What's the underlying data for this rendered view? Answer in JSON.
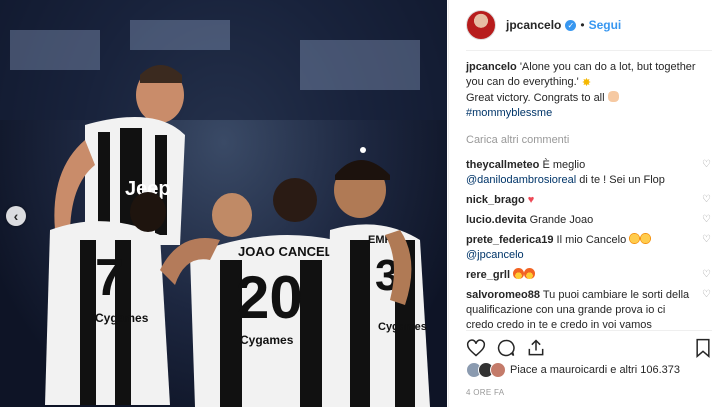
{
  "post": {
    "photo": {
      "description_icon": "photo-icon",
      "jersey_texts": {
        "sponsor": "Jeep",
        "name": "JOAO CANCELO",
        "number_center": "20",
        "number_left": "7",
        "number_right": "3",
        "name_right": "EMRE",
        "sponsor_bottom": "Cygames"
      },
      "prev_icon": "chevron-left-icon"
    },
    "header": {
      "username": "jpcancelo",
      "verified_icon": "verified-badge-icon",
      "separator": "•",
      "follow_label": "Segui"
    },
    "caption": {
      "username": "jpcancelo",
      "text": "'Alone you can do a lot, but together you can do everything.'",
      "text_2": "Great victory. Congrats to all",
      "hashtag": "#mommyblessme"
    },
    "load_more_label": "Carica altri commenti",
    "comments": [
      {
        "username": "theycallmeteo",
        "text": "È meglio",
        "mention": "@danilodambrosioreal",
        "text_after": "di te ! Sei un Flop"
      },
      {
        "username": "nick_brago",
        "text": "",
        "emoji": "red-heart"
      },
      {
        "username": "lucio.devita",
        "text": "Grande Joao"
      },
      {
        "username": "prete_federica19",
        "text": "Il mio Cancelo",
        "mention": "@jpcancelo",
        "emoji": "heart-eyes"
      },
      {
        "username": "rere_grll",
        "text": "",
        "emoji": "fire"
      },
      {
        "username": "salvoromeo88",
        "text": "Tu puoi cambiare le sorti della qualificazione con una grande prova io ci credo credo in te e credo in voi vamos"
      }
    ],
    "actions": {
      "like_icon": "heart-icon",
      "comment_icon": "comment-icon",
      "share_icon": "share-icon",
      "save_icon": "bookmark-icon"
    },
    "likes": {
      "text": "Piace a mauroicardi e altri 106.373"
    },
    "timestamp": "4 ORE FA"
  }
}
